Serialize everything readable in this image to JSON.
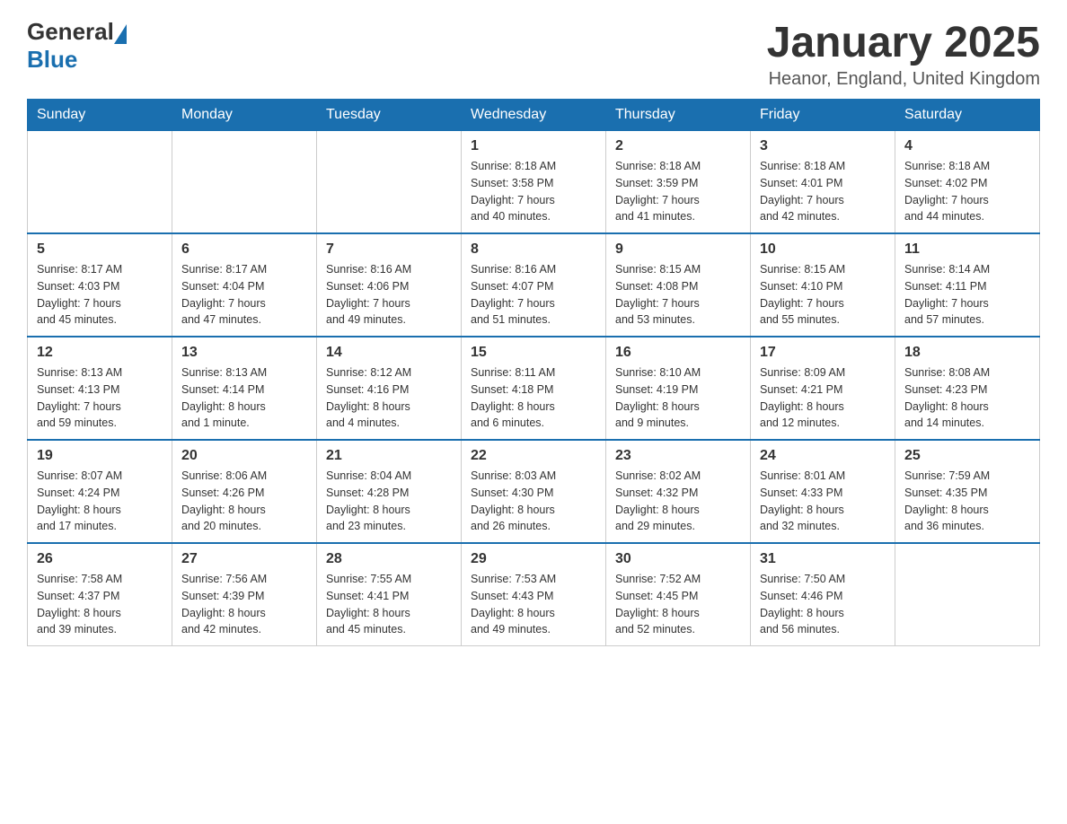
{
  "header": {
    "title": "January 2025",
    "location": "Heanor, England, United Kingdom",
    "logo": {
      "general": "General",
      "blue": "Blue"
    }
  },
  "days_of_week": [
    "Sunday",
    "Monday",
    "Tuesday",
    "Wednesday",
    "Thursday",
    "Friday",
    "Saturday"
  ],
  "weeks": [
    {
      "days": [
        {
          "number": "",
          "info": ""
        },
        {
          "number": "",
          "info": ""
        },
        {
          "number": "",
          "info": ""
        },
        {
          "number": "1",
          "info": "Sunrise: 8:18 AM\nSunset: 3:58 PM\nDaylight: 7 hours\nand 40 minutes."
        },
        {
          "number": "2",
          "info": "Sunrise: 8:18 AM\nSunset: 3:59 PM\nDaylight: 7 hours\nand 41 minutes."
        },
        {
          "number": "3",
          "info": "Sunrise: 8:18 AM\nSunset: 4:01 PM\nDaylight: 7 hours\nand 42 minutes."
        },
        {
          "number": "4",
          "info": "Sunrise: 8:18 AM\nSunset: 4:02 PM\nDaylight: 7 hours\nand 44 minutes."
        }
      ]
    },
    {
      "days": [
        {
          "number": "5",
          "info": "Sunrise: 8:17 AM\nSunset: 4:03 PM\nDaylight: 7 hours\nand 45 minutes."
        },
        {
          "number": "6",
          "info": "Sunrise: 8:17 AM\nSunset: 4:04 PM\nDaylight: 7 hours\nand 47 minutes."
        },
        {
          "number": "7",
          "info": "Sunrise: 8:16 AM\nSunset: 4:06 PM\nDaylight: 7 hours\nand 49 minutes."
        },
        {
          "number": "8",
          "info": "Sunrise: 8:16 AM\nSunset: 4:07 PM\nDaylight: 7 hours\nand 51 minutes."
        },
        {
          "number": "9",
          "info": "Sunrise: 8:15 AM\nSunset: 4:08 PM\nDaylight: 7 hours\nand 53 minutes."
        },
        {
          "number": "10",
          "info": "Sunrise: 8:15 AM\nSunset: 4:10 PM\nDaylight: 7 hours\nand 55 minutes."
        },
        {
          "number": "11",
          "info": "Sunrise: 8:14 AM\nSunset: 4:11 PM\nDaylight: 7 hours\nand 57 minutes."
        }
      ]
    },
    {
      "days": [
        {
          "number": "12",
          "info": "Sunrise: 8:13 AM\nSunset: 4:13 PM\nDaylight: 7 hours\nand 59 minutes."
        },
        {
          "number": "13",
          "info": "Sunrise: 8:13 AM\nSunset: 4:14 PM\nDaylight: 8 hours\nand 1 minute."
        },
        {
          "number": "14",
          "info": "Sunrise: 8:12 AM\nSunset: 4:16 PM\nDaylight: 8 hours\nand 4 minutes."
        },
        {
          "number": "15",
          "info": "Sunrise: 8:11 AM\nSunset: 4:18 PM\nDaylight: 8 hours\nand 6 minutes."
        },
        {
          "number": "16",
          "info": "Sunrise: 8:10 AM\nSunset: 4:19 PM\nDaylight: 8 hours\nand 9 minutes."
        },
        {
          "number": "17",
          "info": "Sunrise: 8:09 AM\nSunset: 4:21 PM\nDaylight: 8 hours\nand 12 minutes."
        },
        {
          "number": "18",
          "info": "Sunrise: 8:08 AM\nSunset: 4:23 PM\nDaylight: 8 hours\nand 14 minutes."
        }
      ]
    },
    {
      "days": [
        {
          "number": "19",
          "info": "Sunrise: 8:07 AM\nSunset: 4:24 PM\nDaylight: 8 hours\nand 17 minutes."
        },
        {
          "number": "20",
          "info": "Sunrise: 8:06 AM\nSunset: 4:26 PM\nDaylight: 8 hours\nand 20 minutes."
        },
        {
          "number": "21",
          "info": "Sunrise: 8:04 AM\nSunset: 4:28 PM\nDaylight: 8 hours\nand 23 minutes."
        },
        {
          "number": "22",
          "info": "Sunrise: 8:03 AM\nSunset: 4:30 PM\nDaylight: 8 hours\nand 26 minutes."
        },
        {
          "number": "23",
          "info": "Sunrise: 8:02 AM\nSunset: 4:32 PM\nDaylight: 8 hours\nand 29 minutes."
        },
        {
          "number": "24",
          "info": "Sunrise: 8:01 AM\nSunset: 4:33 PM\nDaylight: 8 hours\nand 32 minutes."
        },
        {
          "number": "25",
          "info": "Sunrise: 7:59 AM\nSunset: 4:35 PM\nDaylight: 8 hours\nand 36 minutes."
        }
      ]
    },
    {
      "days": [
        {
          "number": "26",
          "info": "Sunrise: 7:58 AM\nSunset: 4:37 PM\nDaylight: 8 hours\nand 39 minutes."
        },
        {
          "number": "27",
          "info": "Sunrise: 7:56 AM\nSunset: 4:39 PM\nDaylight: 8 hours\nand 42 minutes."
        },
        {
          "number": "28",
          "info": "Sunrise: 7:55 AM\nSunset: 4:41 PM\nDaylight: 8 hours\nand 45 minutes."
        },
        {
          "number": "29",
          "info": "Sunrise: 7:53 AM\nSunset: 4:43 PM\nDaylight: 8 hours\nand 49 minutes."
        },
        {
          "number": "30",
          "info": "Sunrise: 7:52 AM\nSunset: 4:45 PM\nDaylight: 8 hours\nand 52 minutes."
        },
        {
          "number": "31",
          "info": "Sunrise: 7:50 AM\nSunset: 4:46 PM\nDaylight: 8 hours\nand 56 minutes."
        },
        {
          "number": "",
          "info": ""
        }
      ]
    }
  ]
}
